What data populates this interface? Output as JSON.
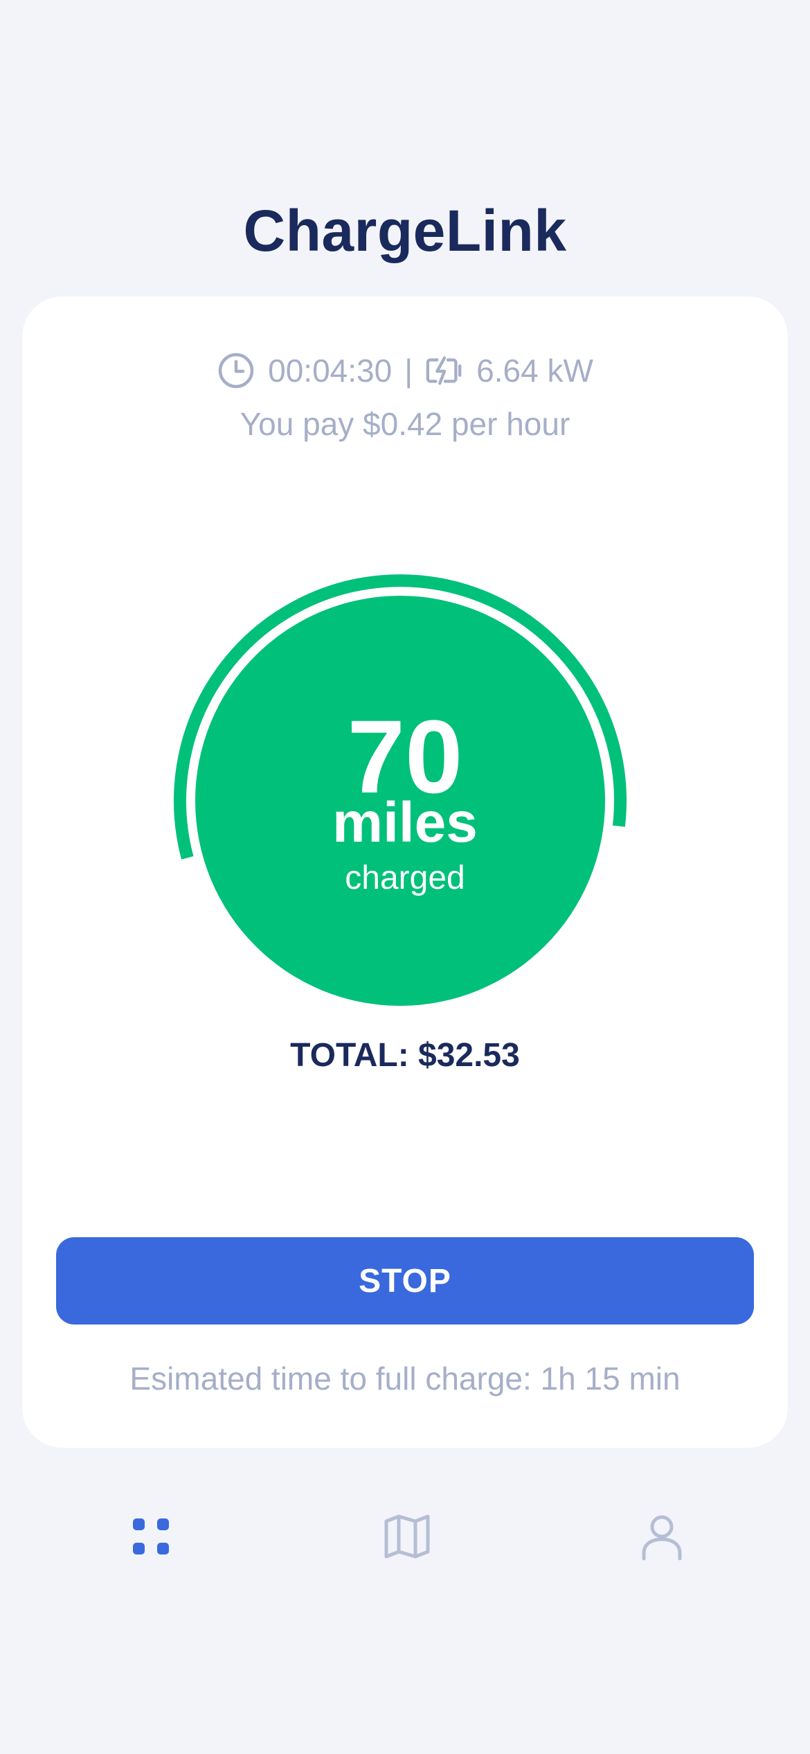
{
  "app": {
    "title": "ChargeLink"
  },
  "session": {
    "elapsed": "00:04:30",
    "separator": "|",
    "power": "6.64 kW",
    "rate_text": "You pay $0.42 per hour",
    "elapsed_icon": "clock-icon",
    "power_icon": "charging-battery-icon"
  },
  "gauge": {
    "value": "70",
    "unit": "miles",
    "label": "charged",
    "progress_percent": 56,
    "color": "#00c07a"
  },
  "total": {
    "text": "TOTAL: $32.53"
  },
  "actions": {
    "stop_label": "STOP",
    "stop_color": "#3a69de"
  },
  "estimate": {
    "text": "Esimated time to full charge: 1h 15 min"
  },
  "nav": {
    "items": [
      {
        "icon": "dashboard-icon",
        "active": true,
        "color": "#3a69de"
      },
      {
        "icon": "map-icon",
        "active": false,
        "color": "#b6bed6"
      },
      {
        "icon": "profile-icon",
        "active": false,
        "color": "#b6bed6"
      }
    ]
  },
  "colors": {
    "background": "#f3f4f9",
    "card": "#ffffff",
    "title": "#1b2a5c",
    "muted_text": "#a6aec8"
  }
}
